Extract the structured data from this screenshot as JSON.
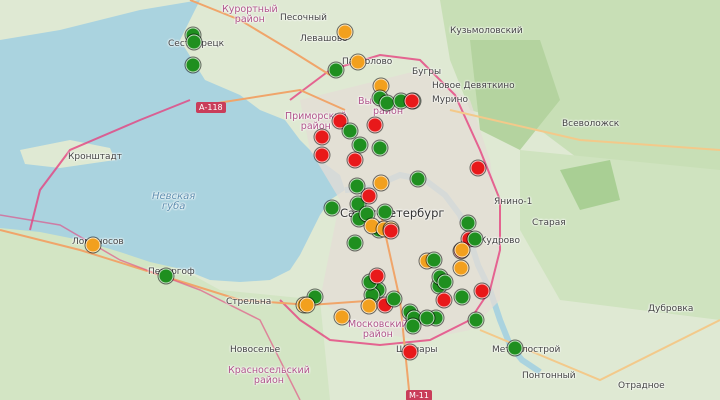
{
  "labels": {
    "kurortny": "Курортный\nрайон",
    "pesochny": "Песочный",
    "levashovo": "Левашово",
    "kuzmolovsky": "Кузьмоловский",
    "sestroretsk": "Сестрорецк",
    "pargolovo": "Парголово",
    "bugry": "Бугры",
    "novoe_devyatkino": "Новое Девяткино",
    "murino": "Мурино",
    "primorsky": "Приморский\nрайон",
    "vyborgsky": "Выборгский\nрайон",
    "kronstadt": "Кронштадт",
    "vsevolozhsk": "Всеволожск",
    "nevskaya_guba": "Невская\nгуба",
    "spb": "Санкт-Петербург",
    "yanino": "Янино-1",
    "staraya": "Старая",
    "kudrovo": "Кудрово",
    "lomonosov": "Ломоносов",
    "peterhof": "Петергоф",
    "strelna": "Стрельна",
    "moskovsky": "Московский\nрайон",
    "dubrovka": "Дубровка",
    "novoselye": "Новоселье",
    "shushary": "Шушары",
    "metallostroy": "Металлострой",
    "krasnoselsky": "Красносельский\nрайон",
    "pontonny": "Понтонный",
    "otradnoe": "Отрадное"
  },
  "road_badges": {
    "a118": "А-118",
    "m11": "М-11"
  },
  "colors": {
    "green": "#1f8f1f",
    "orange": "#f2a01e",
    "red": "#e8191a"
  },
  "markers": [
    {
      "status": "green"
    },
    {
      "status": "green"
    },
    {
      "status": "green"
    },
    {
      "status": "orange"
    },
    {
      "status": "green"
    },
    {
      "status": "orange"
    },
    {
      "status": "orange"
    },
    {
      "status": "green"
    },
    {
      "status": "green"
    },
    {
      "status": "green"
    },
    {
      "status": "green"
    },
    {
      "status": "red"
    },
    {
      "status": "red"
    },
    {
      "status": "red"
    },
    {
      "status": "red"
    },
    {
      "status": "green"
    },
    {
      "status": "green"
    },
    {
      "status": "red"
    },
    {
      "status": "green"
    },
    {
      "status": "red"
    },
    {
      "status": "green"
    },
    {
      "status": "green"
    },
    {
      "status": "green"
    },
    {
      "status": "green"
    },
    {
      "status": "orange"
    },
    {
      "status": "green"
    },
    {
      "status": "red"
    },
    {
      "status": "green"
    },
    {
      "status": "green"
    },
    {
      "status": "green"
    },
    {
      "status": "green"
    },
    {
      "status": "orange"
    },
    {
      "status": "orange"
    },
    {
      "status": "orange"
    },
    {
      "status": "red"
    },
    {
      "status": "red"
    },
    {
      "status": "red"
    },
    {
      "status": "green"
    },
    {
      "status": "green"
    },
    {
      "status": "red"
    },
    {
      "status": "orange"
    },
    {
      "status": "orange"
    },
    {
      "status": "orange"
    },
    {
      "status": "green"
    },
    {
      "status": "green"
    },
    {
      "status": "green"
    },
    {
      "status": "red"
    },
    {
      "status": "red"
    },
    {
      "status": "green"
    },
    {
      "status": "green"
    },
    {
      "status": "green"
    },
    {
      "status": "green"
    },
    {
      "status": "green"
    },
    {
      "status": "green"
    },
    {
      "status": "red"
    },
    {
      "status": "green"
    },
    {
      "status": "orange"
    },
    {
      "status": "orange"
    },
    {
      "status": "green"
    },
    {
      "status": "green"
    },
    {
      "status": "green"
    },
    {
      "status": "green"
    },
    {
      "status": "red"
    },
    {
      "status": "green"
    },
    {
      "status": "green"
    },
    {
      "status": "green"
    },
    {
      "status": "red"
    },
    {
      "status": "orange"
    },
    {
      "status": "green"
    },
    {
      "status": "orange"
    },
    {
      "status": "orange"
    }
  ]
}
